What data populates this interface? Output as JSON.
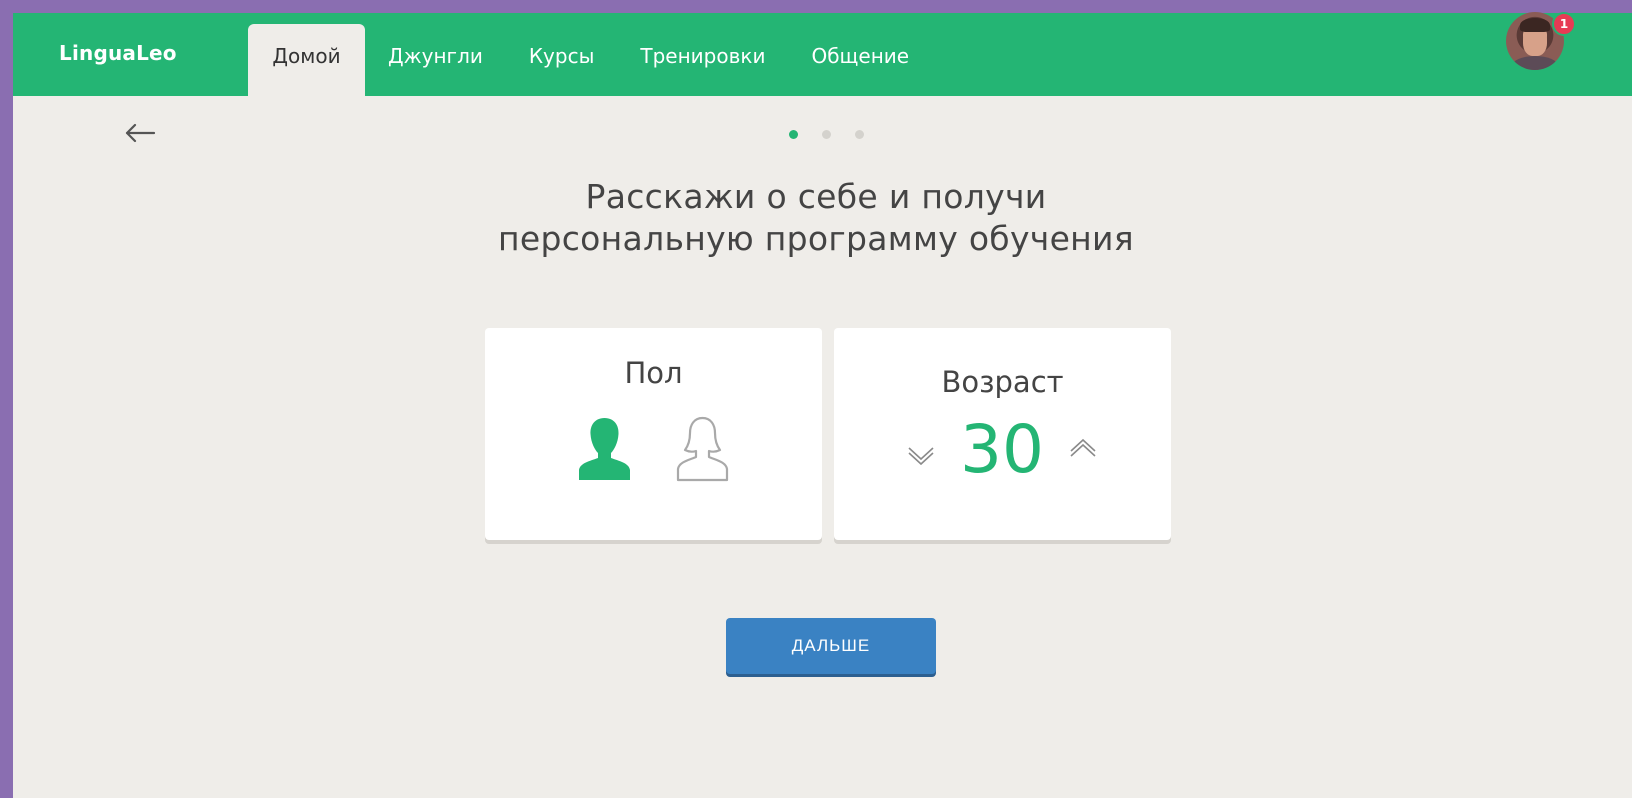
{
  "header": {
    "logo": "LinguaLeo",
    "tabs": [
      {
        "label": "Домой",
        "active": true
      },
      {
        "label": "Джунгли"
      },
      {
        "label": "Курсы"
      },
      {
        "label": "Тренировки"
      },
      {
        "label": "Общение"
      }
    ],
    "notifications": "1"
  },
  "progress": {
    "total_steps": 3,
    "current_step": 1
  },
  "heading": {
    "line1": "Расскажи о себе и получи",
    "line2": "персональную программу обучения"
  },
  "gender_card": {
    "title": "Пол",
    "selected": "male"
  },
  "age_card": {
    "title": "Возраст",
    "value": "30"
  },
  "next_button": {
    "label": "ДАЛЬШЕ"
  },
  "colors": {
    "brand_green": "#24b574",
    "button_blue": "#3a82c3",
    "badge_red": "#e73b54",
    "background": "#efede9"
  }
}
